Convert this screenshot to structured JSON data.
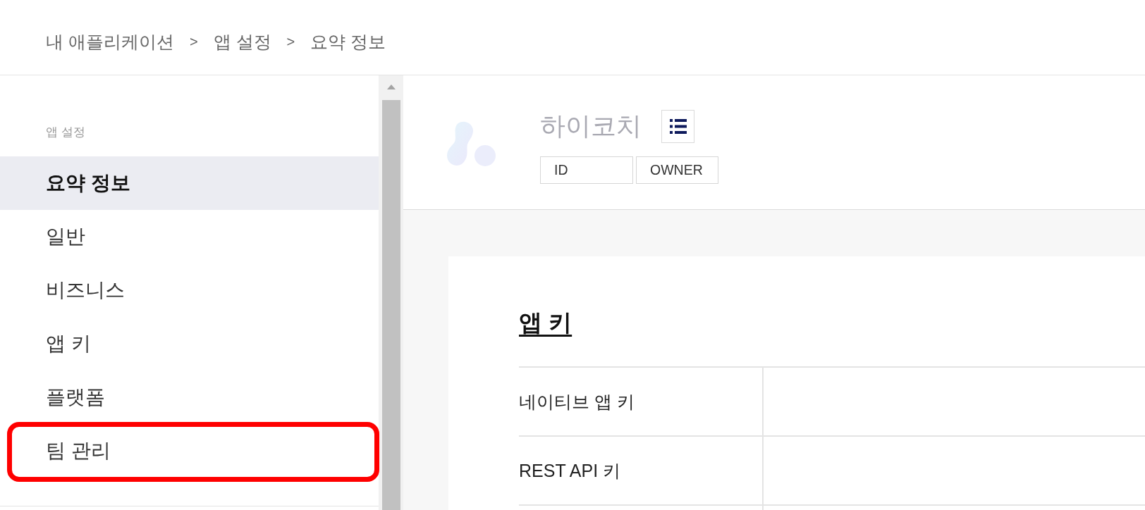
{
  "breadcrumb": [
    {
      "kind": "link",
      "text": "내 애플리케이션"
    },
    {
      "kind": "separator",
      "text": ">"
    },
    {
      "kind": "link",
      "text": "앱 설정"
    },
    {
      "kind": "separator",
      "text": ">"
    },
    {
      "kind": "link",
      "text": "요약 정보"
    }
  ],
  "sidebar": {
    "section_label": "앱 설정",
    "items": [
      {
        "label": "요약 정보",
        "selected": true,
        "highlighted": false
      },
      {
        "label": "일반",
        "selected": false,
        "highlighted": false
      },
      {
        "label": "비즈니스",
        "selected": false,
        "highlighted": false
      },
      {
        "label": "앱 키",
        "selected": false,
        "highlighted": false
      },
      {
        "label": "플랫폼",
        "selected": false,
        "highlighted": false
      },
      {
        "label": "팀 관리",
        "selected": false,
        "highlighted": true
      }
    ]
  },
  "app": {
    "name": "하이코치",
    "tags": [
      "ID",
      "OWNER"
    ]
  },
  "app_keys": {
    "title": "앱 키",
    "rows": [
      {
        "label": "네이티브 앱 키"
      },
      {
        "label": "REST API 키"
      }
    ]
  }
}
